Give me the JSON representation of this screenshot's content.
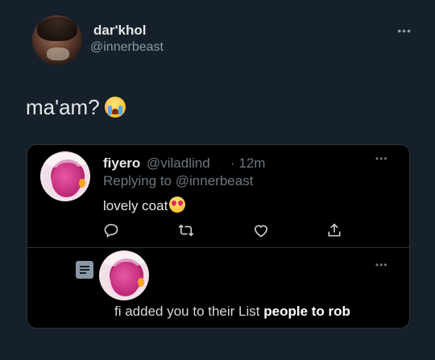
{
  "tweet": {
    "author_name": "dar'khol",
    "author_handle": "@innerbeast",
    "text": "ma'am?",
    "emoji": "loudly-crying-face-emoji",
    "more_icon": "more-horizontal-icon"
  },
  "reply": {
    "author_name": "fiyero",
    "author_handle": "@viladlind",
    "time": "· 12m",
    "replying_to": "Replying to @innerbeast",
    "text": "lovely coat",
    "emoji": "heart-eyes-emoji",
    "actions": [
      "reply-icon",
      "retweet-icon",
      "like-icon",
      "share-icon"
    ]
  },
  "notification": {
    "icon": "list-icon",
    "text_prefix": "fi added you to their List",
    "list_name": "people to rob"
  },
  "colors": {
    "background": "#15202b",
    "card": "#000000",
    "muted": "#6e767d",
    "text": "#e7e7e7"
  }
}
